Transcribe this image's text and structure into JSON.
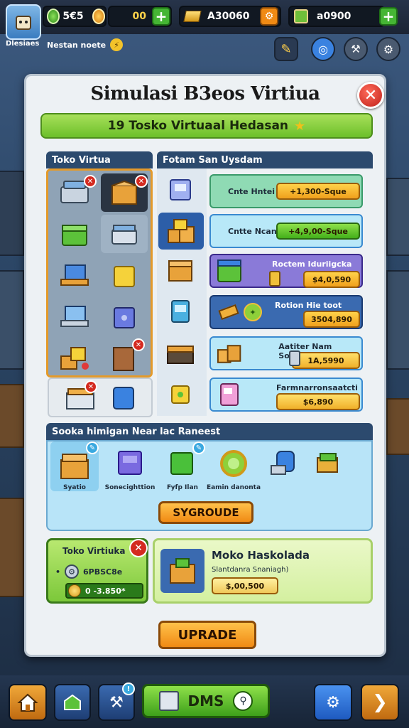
{
  "topbar": {
    "player_name": "Dlesiaes",
    "gems": "5€5",
    "coins": "00",
    "cash": "A30060",
    "resources": "a0900",
    "subtitle": "Nestan noete"
  },
  "panel": {
    "title": "Simulasi B3eos Virtiua",
    "banner": "19 Tosko Virtuaal Hedasan",
    "left_header": "Toko Virtua",
    "right_header": "Fotam San Uysdam"
  },
  "rows": [
    {
      "label": "Cnte Hntei",
      "price": "+1,300-Sque"
    },
    {
      "label": "Cntte Ncan",
      "price": "+4,9,00-Sque"
    },
    {
      "label": "Roctem Iduriigcka",
      "price": "$4,0,590"
    },
    {
      "label": "Rotion Hie toot",
      "price": "3504,890"
    },
    {
      "label": "Aatiter Nam Sotpm",
      "price": "1A,5990"
    },
    {
      "label": "Farmnarronsaatcti",
      "price": "$6,890"
    }
  ],
  "section": {
    "header": "Sooka himigan Near lac Raneest",
    "items": [
      "Syatio",
      "Sonecighttion",
      "Fyfp Ilan",
      "Eamin danonta"
    ],
    "upgrade_label": "SYGROUDE"
  },
  "bottom_card_left": {
    "title": "Toko Virtiuka",
    "line1": "6PBSC8e",
    "line2": "0 -3.850*"
  },
  "bottom_card_right": {
    "title": "Moko Haskolada",
    "subtitle": "Slantdanra Snaniagh)",
    "price": "$,00,500"
  },
  "main_button": "UPRADE",
  "bottom_nav": {
    "center_label": "DMS"
  },
  "colors": {
    "accent_green": "#6cc02a",
    "accent_orange": "#f08a14",
    "header_blue": "#2c4a6e",
    "close_red": "#d42a20"
  }
}
